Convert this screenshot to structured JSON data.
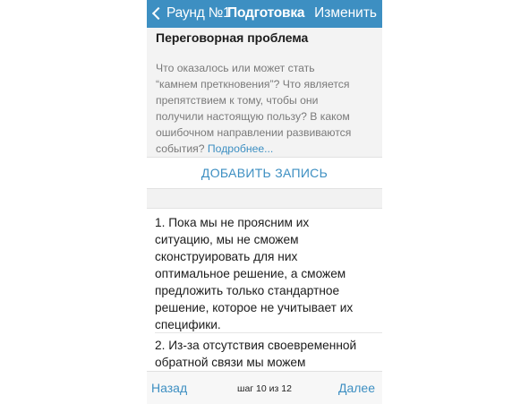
{
  "colors": {
    "accent": "#3d8fc2",
    "nav_background": "#3d8fc2",
    "text_primary": "#1c1c1c",
    "text_secondary": "#7a7a7a"
  },
  "navbar": {
    "back_icon": "chevron-left-icon",
    "back_label": "Раунд №1",
    "title": "Подготовка",
    "edit_label": "Изменить"
  },
  "problem": {
    "title": "Переговорная проблема",
    "description_lines": [
      "Что оказалось или может стать",
      "“камнем преткновения”? Что является",
      "препятствием к тому, чтобы они",
      "получили настоящую пользу? В каком",
      "ошибочном направлении развиваются",
      "события?"
    ],
    "more_link": "Подробнее..."
  },
  "add_record_label": "ДОБАВИТЬ ЗАПИСЬ",
  "entries": [
    {
      "lines": [
        "1. Пока мы не проясним их",
        "ситуацию,  мы не сможем",
        "сконструировать для них",
        "оптимальное решение, а сможем",
        "предложить только стандартное",
        "решение, которое не учитывает их",
        "специфики."
      ]
    },
    {
      "lines": [
        "2. Из-за отсутствия своевременной",
        "обратной связи мы можем"
      ]
    }
  ],
  "toolbar": {
    "back_label": "Назад",
    "step_label": "шаг 10 из 12",
    "next_label": "Далее"
  }
}
